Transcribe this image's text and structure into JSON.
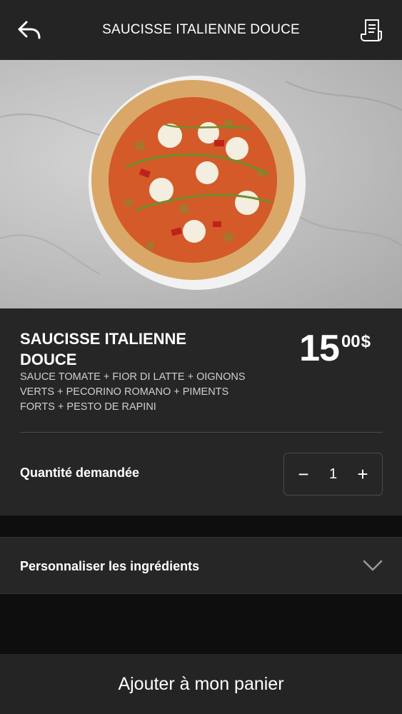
{
  "header": {
    "title": "SAUCISSE ITALIENNE DOUCE",
    "back_icon": "back-arrow-icon",
    "receipt_icon": "receipt-icon"
  },
  "hero": {
    "image_alt": "pizza-photo"
  },
  "product": {
    "name": "SAUCISSE ITALIENNE DOUCE",
    "description": "SAUCE TOMATE + FIOR DI LATTE + OIGNONS VERTS + PECORINO ROMANO + PIMENTS FORTS + PESTO DE RAPINI",
    "price_int": "15",
    "price_cents": "00",
    "currency": "$"
  },
  "quantity": {
    "label": "Quantité demandée",
    "value": "1",
    "minus": "−",
    "plus": "+"
  },
  "customize": {
    "label": "Personnaliser les ingrédients"
  },
  "cta": {
    "label": "Ajouter à mon panier"
  },
  "colors": {
    "header_bg": "#242424",
    "panel_bg": "#262626",
    "page_bg": "#0e0e0e",
    "text": "#ffffff"
  }
}
